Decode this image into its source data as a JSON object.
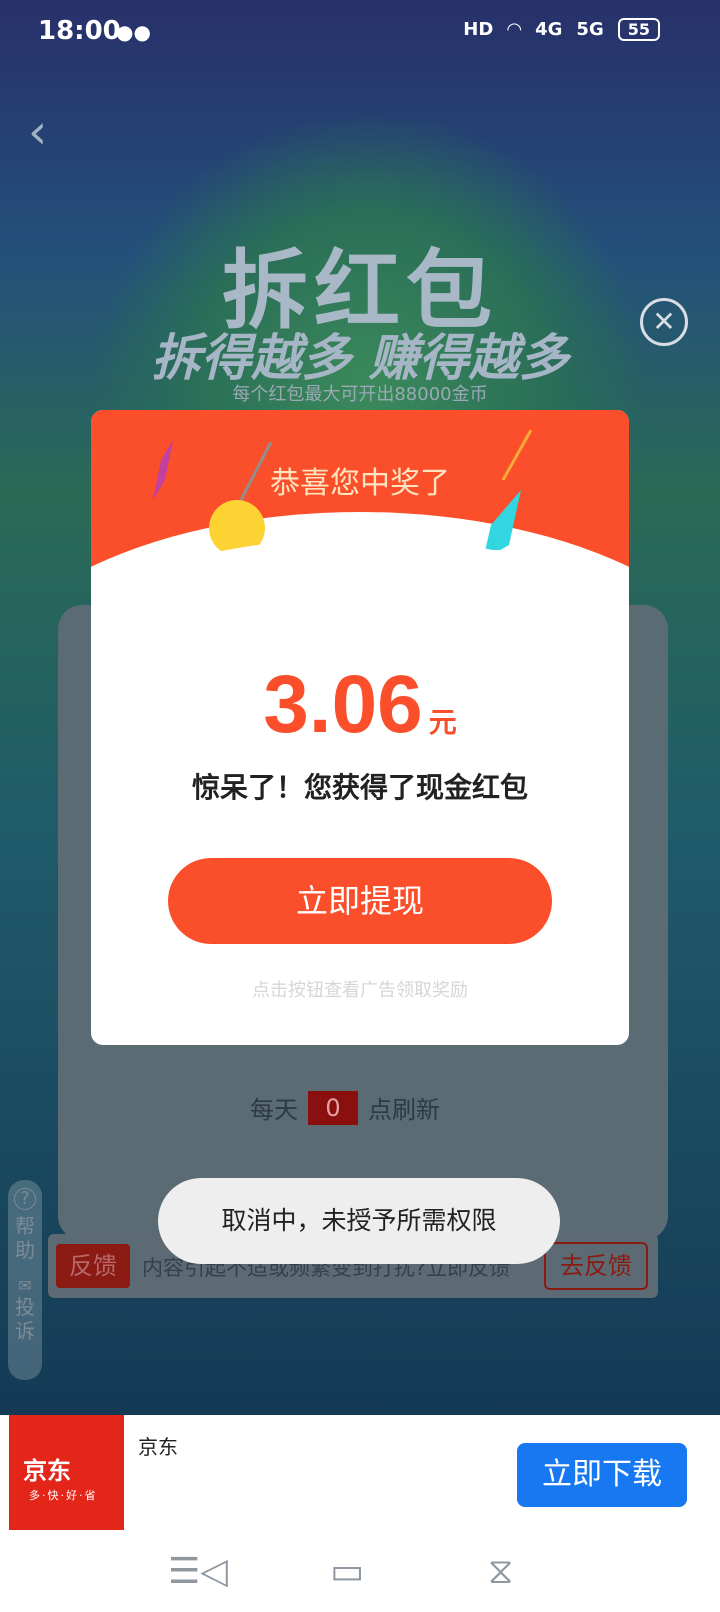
{
  "status_bar": {
    "time": "18:00",
    "wechat_icon": "wechat-icon",
    "network": "HD",
    "signal_1": "4G",
    "signal_2": "5G",
    "battery": "55"
  },
  "hero": {
    "title": "拆红包",
    "subtitle": "拆得越多 赚得越多",
    "note": "每个红包最大可开出88000金币"
  },
  "modal": {
    "header": "恭喜您中奖了",
    "amount": "3.06",
    "unit": "元",
    "description": "惊呆了！您获得了现金红包",
    "claim_button": "立即提现",
    "hint": "点击按钮查看广告领取奖励"
  },
  "refresh": {
    "prefix": "每天",
    "count": "0",
    "suffix": "点刷新"
  },
  "side_tab": {
    "help": "帮助",
    "complaint": "投诉"
  },
  "feedback": {
    "tag": "反馈",
    "text": "内容引起不适或频繁变到打扰?立即反馈",
    "button": "去反馈"
  },
  "toast": {
    "text": "取消中，未授予所需权限"
  },
  "ad": {
    "logo_text": "京东",
    "logo_slogan": "多·快·好·省",
    "name": "京东",
    "download_button": "立即下载"
  },
  "colors": {
    "accent_orange": "#fb4e2a",
    "download_blue": "#1778f2",
    "jd_red": "#e4261a"
  }
}
